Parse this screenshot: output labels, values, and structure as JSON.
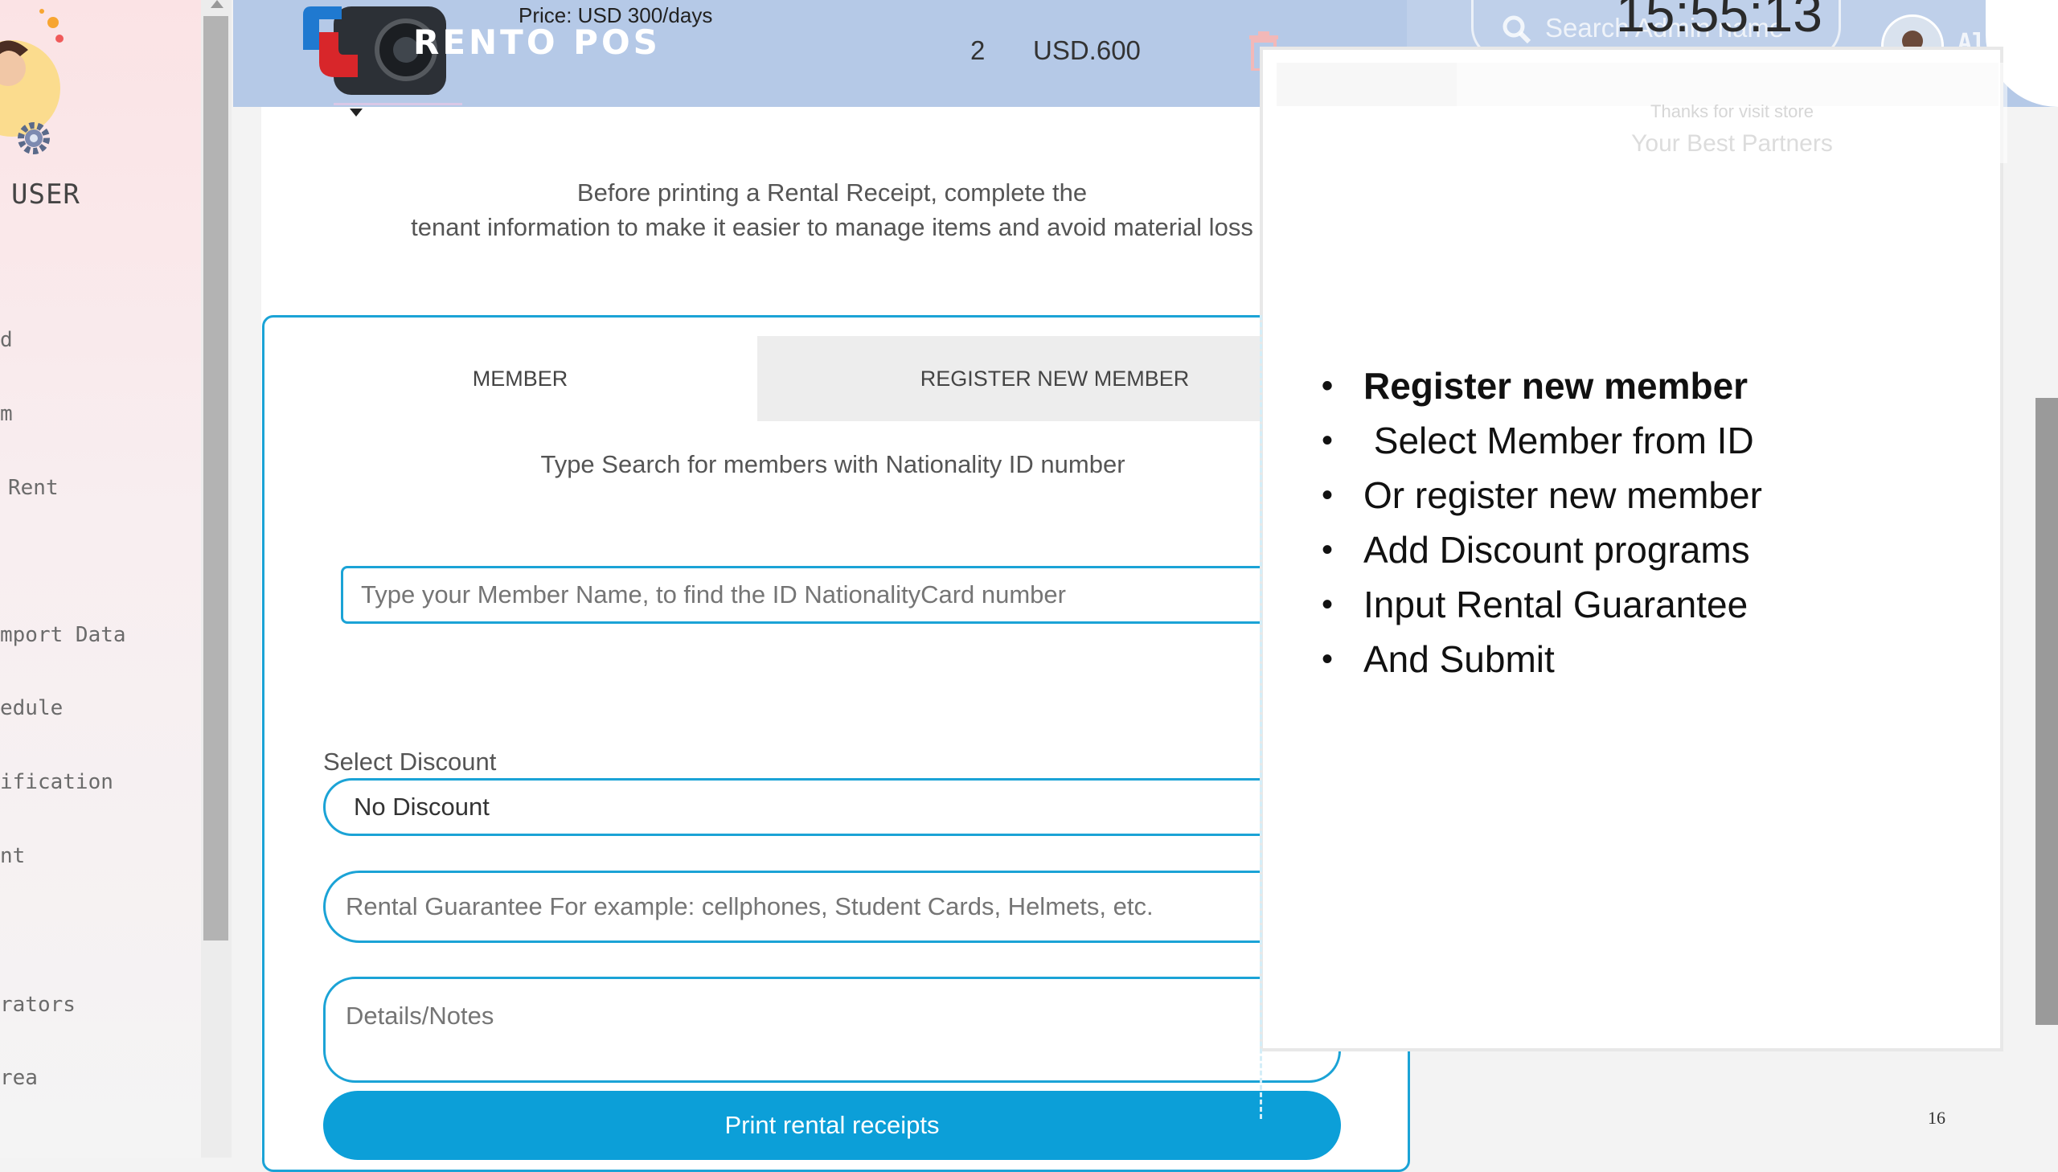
{
  "sidebar": {
    "user_label": "USER",
    "items": [
      "d",
      "m",
      "Rent",
      "mport Data",
      "edule",
      "ification",
      "nt",
      "rators",
      "rea"
    ]
  },
  "header": {
    "brand": "RENTO POS",
    "price": "Price: USD 300/days",
    "quantity": "2",
    "total": "USD.600",
    "search_placeholder": "Search Admin name",
    "clock": "15:55:13",
    "admin_name": "Ali"
  },
  "receipt_preview": {
    "thanks": "Thanks for visit store",
    "partners": "Your Best Partners"
  },
  "form": {
    "intro_line1": "Before printing a Rental Receipt, complete the",
    "intro_line2": "tenant information to make it easier to manage items and avoid material loss",
    "tabs": [
      {
        "label": "MEMBER"
      },
      {
        "label": "REGISTER NEW MEMBER"
      }
    ],
    "search_hint": "Type Search for members with Nationality ID number",
    "member_input_placeholder": "Type your Member Name, to find the ID NationalityCard number",
    "discount_label": "Select Discount",
    "discount_value": "No Discount",
    "guarantee_placeholder": "Rental Guarantee For example: cellphones, Student Cards, Helmets, etc.",
    "notes_placeholder": "Details/Notes",
    "submit_label": "Print rental receipts"
  },
  "bullets": [
    {
      "text": "Register new member",
      "bold": true
    },
    {
      "text": " Select Member from ID",
      "bold": false
    },
    {
      "text": "Or register new member",
      "bold": false
    },
    {
      "text": "Add Discount programs",
      "bold": false
    },
    {
      "text": "Input Rental Guarantee",
      "bold": false
    },
    {
      "text": "And Submit",
      "bold": false
    }
  ],
  "page_number": "16",
  "colors": {
    "accent": "#0c9fd8",
    "border": "#1ba3d6",
    "header": "#b5c9e7"
  }
}
